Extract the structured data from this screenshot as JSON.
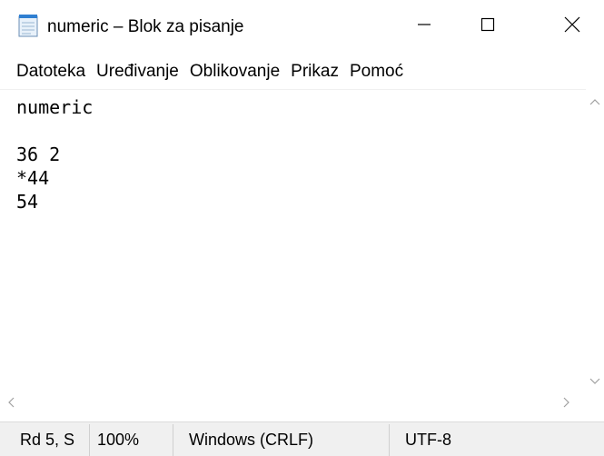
{
  "window": {
    "title": "numeric – Blok za pisanje",
    "icon": "notepad-icon",
    "controls": {
      "minimize": "minimize-icon",
      "maximize": "maximize-icon",
      "close": "close-icon"
    }
  },
  "menu": {
    "items": [
      {
        "label": "Datoteka"
      },
      {
        "label": "Uređivanje"
      },
      {
        "label": "Oblikovanje"
      },
      {
        "label": "Prikaz"
      },
      {
        "label": "Pomoć"
      }
    ]
  },
  "editor": {
    "content": "numeric\n\n36 2\n*44\n54"
  },
  "status": {
    "position": "Rd 5, S",
    "zoom": "100%",
    "line_ending": "Windows (CRLF)",
    "encoding": "UTF-8"
  },
  "colors": {
    "status_bg": "#f0f0f0",
    "scroll_arrow": "#a0a0a0"
  }
}
